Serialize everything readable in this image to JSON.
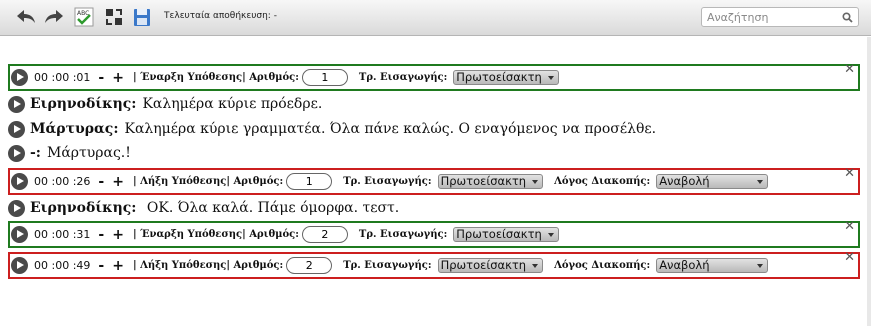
{
  "toolbar": {
    "buttons": [
      {
        "name": "undo-icon"
      },
      {
        "name": "redo-icon"
      },
      {
        "name": "spellcheck-icon"
      },
      {
        "name": "replace-icon"
      },
      {
        "name": "save-icon"
      }
    ],
    "last_saved": "Τελευταία αποθήκευση: -",
    "search_placeholder": "Αναζήτηση"
  },
  "transcript": [
    {
      "kind": "event",
      "status": "start",
      "time": "00 :00 :01",
      "minus": "-",
      "plus": "+",
      "label": "| Έναρξη Υπόθεσης| Αριθμός:",
      "number": "1",
      "type_label": "Τρ. Εισαγωγής:",
      "type_value": "Πρωτοείσακτη"
    },
    {
      "kind": "speech",
      "speaker": "Ειρηνοδίκης:",
      "text": "Καλημέρα κύριε πρόεδρε."
    },
    {
      "kind": "speech",
      "speaker": "Μάρτυρας:",
      "text": "Καλημέρα κύριε γραμματέα.  Όλα πάνε καλώς. Ο εναγόμενος να προσέλθε."
    },
    {
      "kind": "speech",
      "speaker": "-:",
      "text": "Μάρτυρας.!"
    },
    {
      "kind": "event",
      "status": "end",
      "time": "00 :00 :26",
      "minus": "-",
      "plus": "+",
      "label": "| Λήξη Υπόθεσης| Αριθμός:",
      "number": "1",
      "type_label": "Τρ. Εισαγωγής:",
      "type_value": "Πρωτοείσακτη",
      "reason_label": "Λόγος Διακοπής:",
      "reason_value": "Αναβολή"
    },
    {
      "kind": "speech",
      "speaker": "Ειρηνοδίκης:",
      "text": " ΟΚ. Όλα καλά. Πάμε όμορφα. τεστ."
    },
    {
      "kind": "event",
      "status": "start",
      "time": "00 :00 :31",
      "minus": "-",
      "plus": "+",
      "label": "| Έναρξη Υπόθεσης| Αριθμός:",
      "number": "2",
      "type_label": "Τρ. Εισαγωγής:",
      "type_value": "Πρωτοείσακτη"
    },
    {
      "kind": "event",
      "status": "end",
      "time": "00 :00 :49",
      "minus": "-",
      "plus": "+",
      "label": "| Λήξη Υπόθεσης| Αριθμός:",
      "number": "2",
      "type_label": "Τρ. Εισαγωγής:",
      "type_value": "Πρωτοείσακτη",
      "reason_label": "Λόγος Διακοπής:",
      "reason_value": "Αναβολή"
    }
  ],
  "close_glyph": "✕",
  "colors": {
    "start_border": "#1f7a1f",
    "end_border": "#cc1f1f"
  }
}
